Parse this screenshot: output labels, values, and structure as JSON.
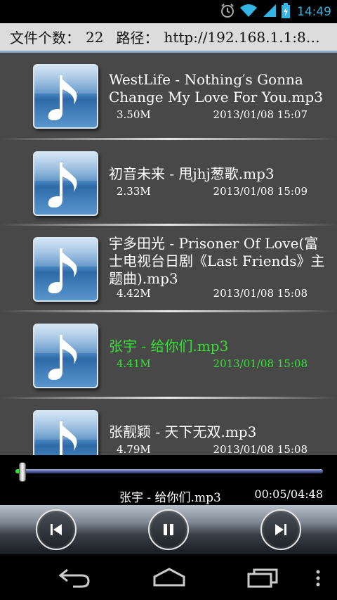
{
  "status_bar": {
    "time": "14:49",
    "icons": [
      "alarm-icon",
      "wifi-icon",
      "signal-icon",
      "battery-charging-icon"
    ],
    "accent_color": "#33b5e5"
  },
  "info_bar": {
    "count_label": "文件个数：",
    "count_value": "22",
    "path_label": "路径：",
    "path_value": "http://192.168.1.1:8…"
  },
  "files": [
    {
      "title": "WestLife - Nothing′s Gonna Change My Love For You.mp3",
      "size": "3.50M",
      "date": "2013/01/08 15:07",
      "icon": "music-note-icon",
      "active": false
    },
    {
      "title": "初音未来 - 甩jhj葱歌.mp3",
      "size": "2.33M",
      "date": "2013/01/08 15:09",
      "icon": "music-note-icon",
      "active": false
    },
    {
      "title": "宇多田光 - Prisoner Of Love(富士电视台日剧《Last Friends》主题曲).mp3",
      "size": "4.42M",
      "date": "2013/01/08 15:08",
      "icon": "music-note-icon",
      "active": false
    },
    {
      "title": "张宇 - 给你们.mp3",
      "size": "4.41M",
      "date": "2013/01/08 15:08",
      "icon": "music-note-icon",
      "active": true
    },
    {
      "title": "张靓颖 - 天下无双.mp3",
      "size": "4.79M",
      "date": "2013/01/08 15:08",
      "icon": "music-note-icon",
      "active": false
    }
  ],
  "player": {
    "now_playing": "张宇 - 给你们.mp3",
    "time_readout": "00:05/04:48",
    "progress_fraction": 0.017,
    "active_color": "#36e136"
  },
  "controls": {
    "previous_icon": "skip-previous-icon",
    "pause_icon": "pause-icon",
    "next_icon": "skip-next-icon"
  },
  "nav_bar": {
    "back_icon": "back-icon",
    "home_icon": "home-icon",
    "recents_icon": "recents-icon",
    "menu_icon": "overflow-menu-icon"
  }
}
